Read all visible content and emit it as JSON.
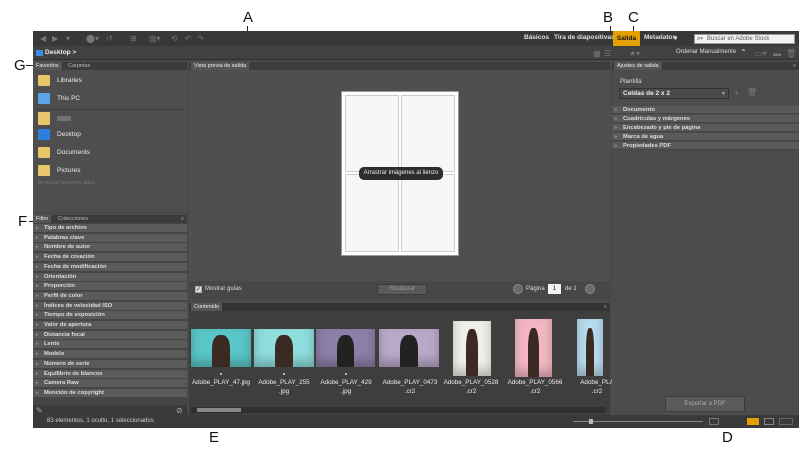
{
  "callouts": {
    "a": "A",
    "b": "B",
    "c": "C",
    "d": "D",
    "e": "E",
    "f": "F",
    "g": "G"
  },
  "toolbar": {
    "workspaces": [
      "Básicos",
      "Tira de diapositivas"
    ],
    "active_workspace": "Salida",
    "metadata_menu": "Metadatos",
    "search_placeholder": "Buscar en Adobe Stock",
    "search_icon": "search-icon"
  },
  "path": {
    "folder": "Desktop",
    "chevron": ">"
  },
  "sort": {
    "label": "Ordenar Manualmente"
  },
  "left": {
    "tabs": [
      "Favoritos",
      "Carpetas"
    ],
    "favorites": [
      {
        "label": "Libraries",
        "icon": "libraries-icon",
        "color": "#e8c46a"
      },
      {
        "label": "This PC",
        "icon": "pc-icon",
        "color": "#5aa4e8"
      },
      {
        "label": "",
        "icon": "user-folder-icon",
        "color": "#e8c46a"
      },
      {
        "label": "Desktop",
        "icon": "desktop-icon",
        "color": "#2a7fe0"
      },
      {
        "label": "Documents",
        "icon": "documents-icon",
        "color": "#e8c46a"
      },
      {
        "label": "Pictures",
        "icon": "pictures-icon",
        "color": "#e8c46a"
      }
    ],
    "fav_hint": "Arrastrar favoritos aquí...",
    "filter_tabs": [
      "Filtro",
      "Colecciones"
    ],
    "filters": [
      "Tipo de archivo",
      "Palabras clave",
      "Nombre de autor",
      "Fecha de creación",
      "Fecha de modificación",
      "Orientación",
      "Proporción",
      "Perfil de color",
      "Índices de velocidad ISO",
      "Tiempo de exposición",
      "Valor de apertura",
      "Distancia focal",
      "Lente",
      "Modelo",
      "Número de serie",
      "Equilibrio de blancos",
      "Camera Raw",
      "Mención de copyright"
    ]
  },
  "preview": {
    "tab": "Vista previa de salida",
    "drop_label": "Arrastrar imágenes al lienzo",
    "show_guides": "Mostrar guías",
    "restore": "Restaurar",
    "page_label": "Página",
    "page_num": "1",
    "page_of": "de 1"
  },
  "content": {
    "tab": "Contenido",
    "items": [
      {
        "line1": "Adobe_PLAY_47.jpg",
        "line2": "",
        "color": "#59c6c8"
      },
      {
        "line1": "Adobe_PLAY_255",
        "line2": ".jpg",
        "color": "#8fdede"
      },
      {
        "line1": "Adobe_PLAY_429",
        "line2": ".jpg",
        "color": "#8c7fa8"
      },
      {
        "line1": "Adobe_PLAY_0473",
        "line2": ".cr2",
        "color": "#b9a9c9"
      },
      {
        "line1": "Adobe_PLAY_0528",
        "line2": ".cr2",
        "color": "#f0eee8"
      },
      {
        "line1": "Adobe_PLAY_0566",
        "line2": ".cr2",
        "color": "#f3b7c4"
      },
      {
        "line1": "Adobe_PLA",
        "line2": ".cr2",
        "color": "#b8dcef"
      }
    ]
  },
  "output": {
    "tab": "Ajustes de salida",
    "template_label": "Plantilla",
    "template_value": "Celdas de 2 x 2",
    "sections": [
      "Documento",
      "Cuadrículas y márgenes",
      "Encabezado y pie de página",
      "Marca de agua",
      "Propiedades PDF"
    ],
    "export_button": "Exportar a PDF"
  },
  "status": {
    "text": "83 elementos, 1 oculto, 1 seleccionados"
  },
  "colors": {
    "accent": "#e4a000",
    "bg": "#4a4a4a"
  }
}
